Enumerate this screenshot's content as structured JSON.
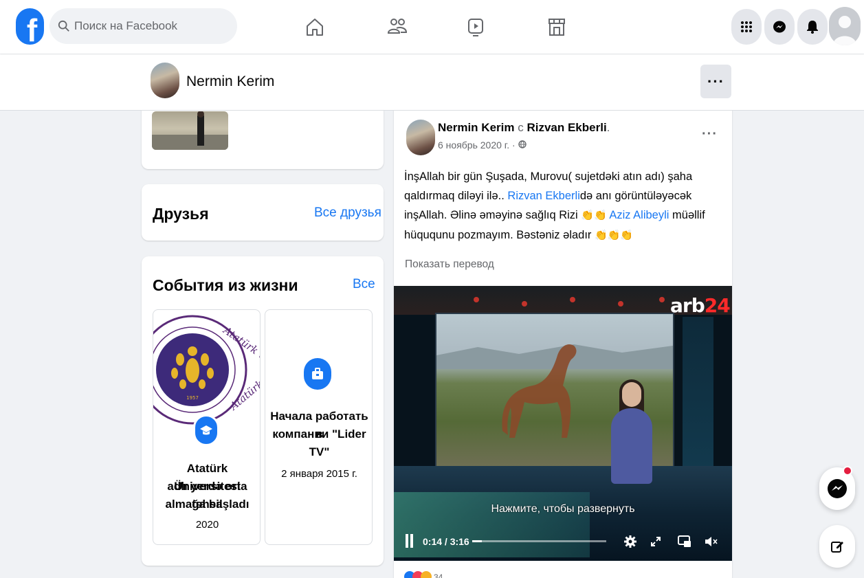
{
  "topbar": {
    "search_placeholder": "Поиск на Facebook",
    "logo_letter": "f",
    "nav": [
      "home-icon",
      "friends-icon",
      "watch-icon",
      "marketplace-icon"
    ],
    "right": [
      "menu-grid-icon",
      "messenger-icon",
      "notifications-icon",
      "avatar"
    ]
  },
  "profile": {
    "name": "Nermin Kerim",
    "more": "···"
  },
  "friends_card": {
    "title": "Друзья",
    "link": "Все друзья"
  },
  "events_card": {
    "title": "События из жизни",
    "link": "Все",
    "events": [
      {
        "line1": "Atatürk Üniversitesi",
        "line2": "adlı yerdə orta təhsil",
        "line3": "almağa başladı",
        "date": "2020",
        "seal_text_top": "Atatürk Üniversitesi",
        "seal_text_bottom": "Atatürk University",
        "seal_year": "1957"
      },
      {
        "line1": "Начала работать в",
        "line2": "компании \"Lider",
        "line3": "TV\"",
        "date": "2 января 2015 г."
      }
    ]
  },
  "post": {
    "author": "Nermin Kerim",
    "with_word": "с",
    "tagged": "Rizvan Ekberli",
    "date": "6 ноябрь 2020 г. ·",
    "more": "···",
    "text_part1": "İnşAllah bir gün Şuşada, Murovu( sujetdəki atın adı) şaha qaldırmaq diləyi ilə.. ",
    "link1": "Rizvan Ekberli",
    "text_part2": "də anı görüntüləyəcək inşAllah. Əlinə əməyinə sağlıq Rizi ",
    "link2": "Aziz Alibeyli",
    "text_part3": " müəllif hüququnu pozmayım. Bəstəniz əladır ",
    "translate": "Показать перевод",
    "video": {
      "logo_a": "arb",
      "logo_b": "24",
      "overlay": "Нажмите, чтобы развернуть",
      "time": "0:14 / 3:16",
      "progress": 0.07
    },
    "reactions_count": "34"
  },
  "colors": {
    "brand": "#1877f2",
    "bg": "#f0f2f5",
    "notification": "#e41e3f"
  }
}
